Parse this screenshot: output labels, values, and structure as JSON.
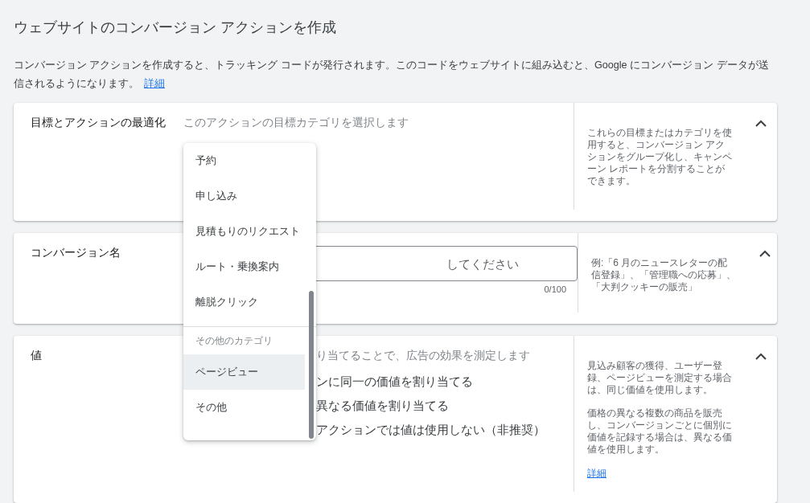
{
  "page": {
    "title": "ウェブサイトのコンバージョン アクションを作成",
    "intro": "コンバージョン アクションを作成すると、トラッキング コードが発行されます。このコードをウェブサイトに組み込むと、Google にコンバージョン データが送信されるようになります。",
    "intro_link": "詳細"
  },
  "sections": [
    {
      "kind": "goal",
      "label": "目標とアクションの最適化",
      "description": "このアクションの目標カテゴリを選択します",
      "help": [
        "これらの目標またはカテゴリを使用すると、コンバージョン アクションをグループ化し、キャンペーン レポートを分割することができます。"
      ],
      "expanded": true
    },
    {
      "kind": "name",
      "label": "コンバージョン名",
      "placeholder": "してください",
      "counter": "0/100",
      "help": [
        "例:「6 月のニュースレターの配信登録」、「管理職への応募」、「大判クッキーの販売」"
      ],
      "expanded": true
    },
    {
      "kind": "value",
      "label": "値",
      "description": "り当てることで、広告の効果を測定します",
      "options": [
        "ンに同一の価値を割り当てる",
        "異なる価値を割り当てる",
        "アクションでは値は使用しない（非推奨）"
      ],
      "help": [
        "見込み顧客の獲得、ユーザー登録、ページビューを測定する場合は、同じ価値を使用します。",
        "価格の異なる複数の商品を販売し、コンバージョンごとに個別に価値を記録する場合は、異なる価値を使用します。"
      ],
      "help_link": "詳細",
      "expanded": true
    }
  ],
  "menu": {
    "groups": [
      {
        "options": [
          {
            "label": "予約",
            "selected": false
          },
          {
            "label": "申し込み",
            "selected": false
          },
          {
            "label": "見積もりのリクエスト",
            "selected": false
          },
          {
            "label": "ルート・乗換案内",
            "selected": false
          },
          {
            "label": "離脱クリック",
            "selected": false
          }
        ]
      },
      {
        "header": "その他のカテゴリ",
        "options": [
          {
            "label": "ページビュー",
            "selected": true
          },
          {
            "label": "その他",
            "selected": false
          }
        ]
      }
    ]
  }
}
